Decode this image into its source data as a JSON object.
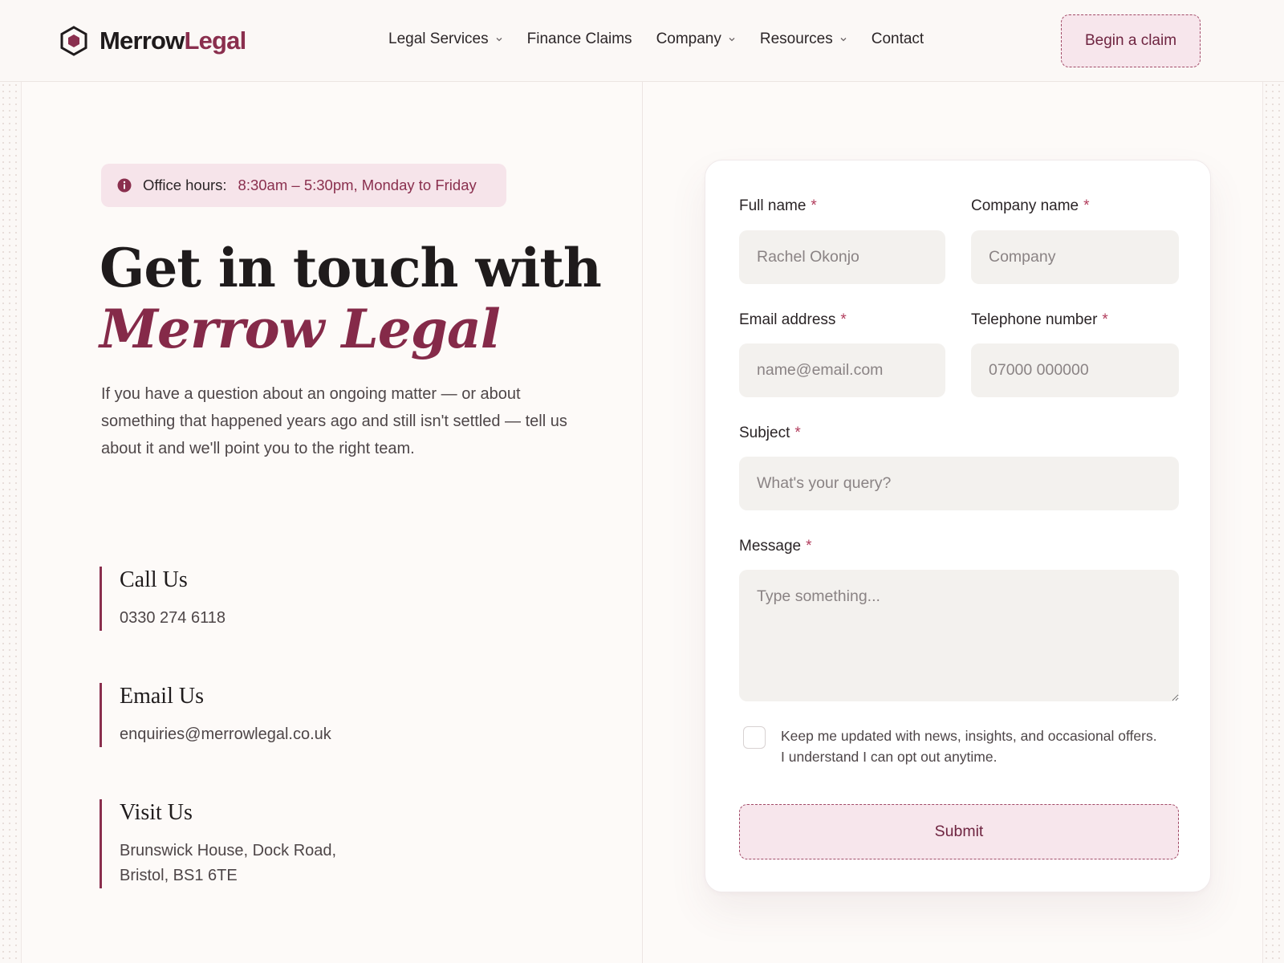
{
  "brand": {
    "name_part1": "Merrow",
    "name_part2": "Legal",
    "accent_color": "#8a2f4e"
  },
  "nav": {
    "items": [
      {
        "label": "Legal Services",
        "has_dropdown": true
      },
      {
        "label": "Finance Claims",
        "has_dropdown": false
      },
      {
        "label": "Company",
        "has_dropdown": true
      },
      {
        "label": "Resources",
        "has_dropdown": true
      },
      {
        "label": "Contact",
        "has_dropdown": false
      }
    ],
    "cta_label": "Begin a claim"
  },
  "hero": {
    "hours_label": "Office hours:",
    "hours_value": "8:30am – 5:30pm, Monday to Friday",
    "title_line1": "Get in touch with",
    "title_line2": "Merrow Legal",
    "description": "If you have a question about an ongoing matter — or about something that happened years ago and still isn't settled — tell us about it and we'll point you to the right team."
  },
  "contacts": [
    {
      "title": "Call Us",
      "lines": [
        "0330 274 6118"
      ]
    },
    {
      "title": "Email Us",
      "lines": [
        "enquiries@merrowlegal.co.uk"
      ]
    },
    {
      "title": "Visit Us",
      "lines": [
        "Brunswick House, Dock Road,",
        "Bristol, BS1 6TE"
      ]
    }
  ],
  "form": {
    "required_marker": "*",
    "full_name": {
      "label": "Full name",
      "placeholder": "Rachel Okonjo"
    },
    "company": {
      "label": "Company name",
      "placeholder": "Company"
    },
    "email": {
      "label": "Email address",
      "placeholder": "name@email.com"
    },
    "phone": {
      "label": "Telephone number",
      "placeholder": "07000 000000"
    },
    "subject": {
      "label": "Subject",
      "placeholder": "What's your query?"
    },
    "message": {
      "label": "Message",
      "placeholder": "Type something..."
    },
    "consent_line1": "Keep me updated with news, insights, and occasional offers.",
    "consent_line2": "I understand I can opt out anytime.",
    "consent_checked": false,
    "submit_label": "Submit"
  }
}
